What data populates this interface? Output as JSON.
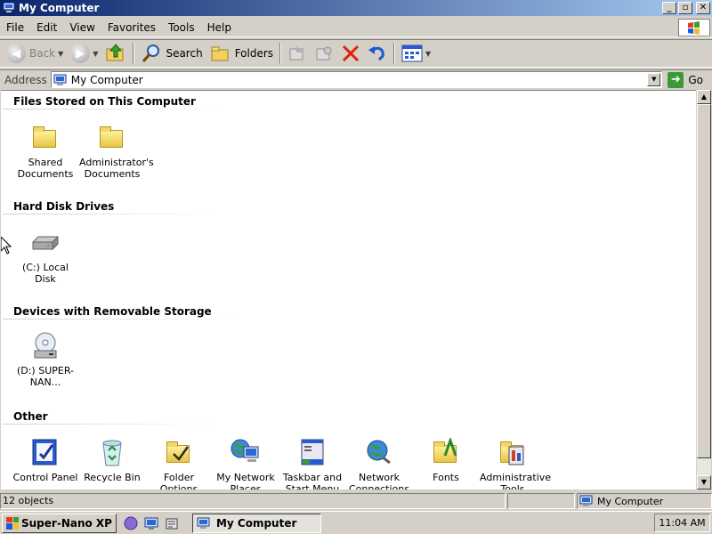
{
  "window": {
    "title": "My Computer"
  },
  "menubar": {
    "items": [
      "File",
      "Edit",
      "View",
      "Favorites",
      "Tools",
      "Help"
    ]
  },
  "toolbar": {
    "back_label": "Back",
    "search_label": "Search",
    "folders_label": "Folders"
  },
  "address": {
    "label": "Address",
    "value": "My Computer",
    "go_label": "Go"
  },
  "groups": [
    {
      "title": "Files Stored on This Computer",
      "items": [
        {
          "label": "Shared Documents",
          "icon": "folder-icon"
        },
        {
          "label": "Administrator's Documents",
          "icon": "folder-icon"
        }
      ]
    },
    {
      "title": "Hard Disk Drives",
      "items": [
        {
          "label": "(C:) Local Disk",
          "icon": "hard-disk-icon"
        }
      ]
    },
    {
      "title": "Devices with Removable Storage",
      "items": [
        {
          "label": "(D:) SUPER-NAN...",
          "icon": "cd-drive-icon"
        }
      ]
    },
    {
      "title": "Other",
      "items": [
        {
          "label": "Control Panel",
          "icon": "control-panel-icon"
        },
        {
          "label": "Recycle Bin",
          "icon": "recycle-bin-icon"
        },
        {
          "label": "Folder Options",
          "icon": "folder-options-icon"
        },
        {
          "label": "My Network Places",
          "icon": "network-places-icon"
        },
        {
          "label": "Taskbar and Start Menu",
          "icon": "taskbar-icon"
        },
        {
          "label": "Network Connections",
          "icon": "network-connections-icon"
        },
        {
          "label": "Fonts",
          "icon": "fonts-icon"
        },
        {
          "label": "Administrative Tools",
          "icon": "admin-tools-icon"
        }
      ]
    }
  ],
  "statusbar": {
    "objects": "12 objects",
    "location": "My Computer"
  },
  "taskbar": {
    "start_label": "Super-Nano XP",
    "task_label": "My Computer",
    "clock": "11:04 AM"
  }
}
